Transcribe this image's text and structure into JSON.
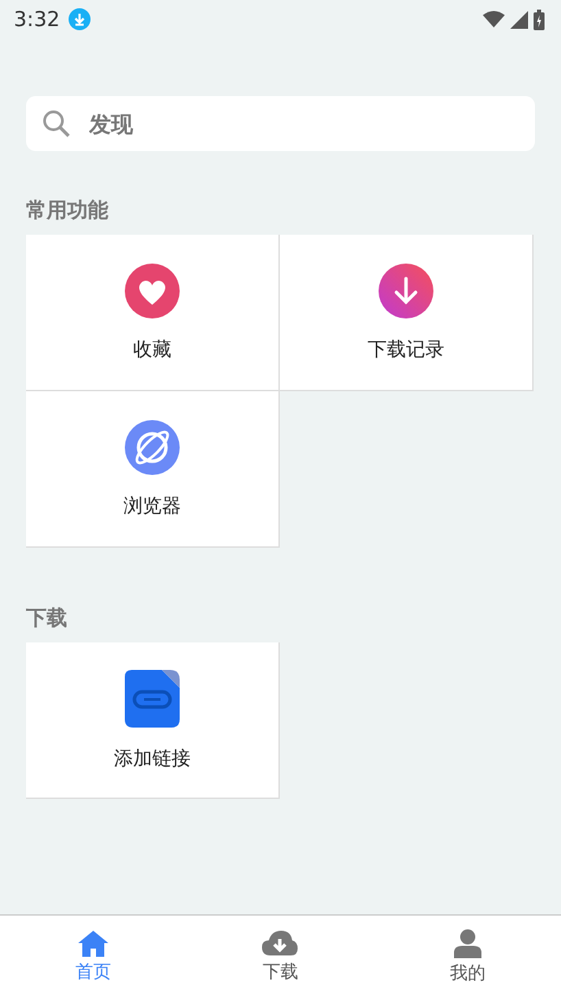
{
  "status_bar": {
    "time": "3:32"
  },
  "search": {
    "placeholder": "发现"
  },
  "sections": [
    {
      "title": "常用功能",
      "items": [
        {
          "label": "收藏",
          "kind": "heart"
        },
        {
          "label": "下载记录",
          "kind": "download"
        },
        {
          "label": "浏览器",
          "kind": "planet"
        }
      ]
    },
    {
      "title": "下载",
      "items": [
        {
          "label": "添加链接",
          "kind": "link"
        }
      ]
    }
  ],
  "tab_bar": [
    {
      "label": "首页",
      "kind": "home",
      "selected": true
    },
    {
      "label": "下载",
      "kind": "cloud",
      "selected": false
    },
    {
      "label": "我的",
      "kind": "user",
      "selected": false
    }
  ]
}
